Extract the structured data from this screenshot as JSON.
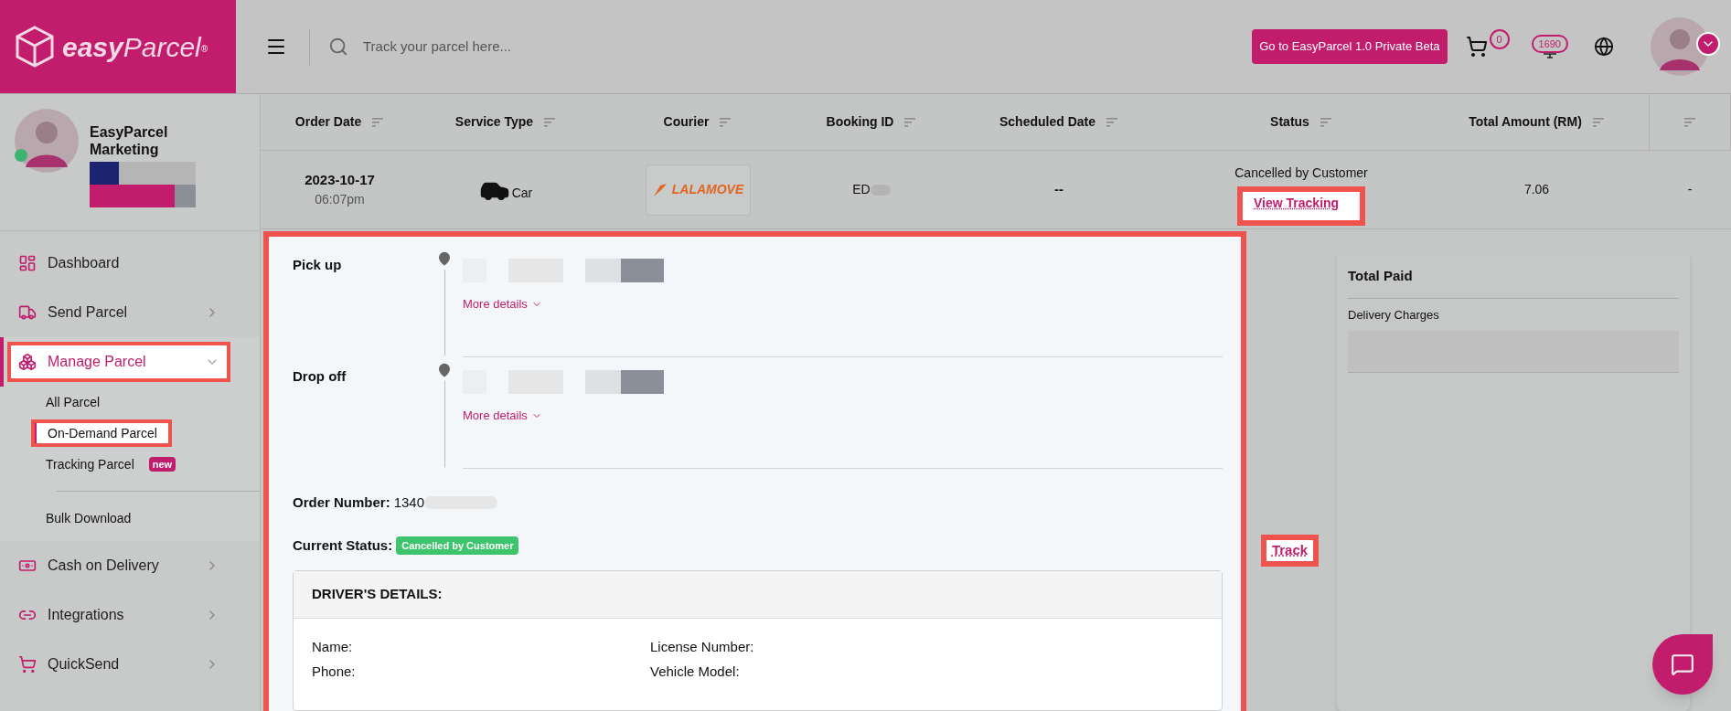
{
  "header": {
    "logo": {
      "word": "easy",
      "word2": "Parcel",
      "mark": "®"
    },
    "search": {
      "placeholder": "Track your parcel here..."
    },
    "beta_button": "Go to EasyParcel 1.0 Private Beta",
    "cart_count": "0",
    "credits": "1690"
  },
  "sidebar": {
    "profile": {
      "name": "EasyParcel Marketing",
      "online": true
    },
    "items": [
      {
        "kind": "dashboard",
        "label": "Dashboard",
        "selected": false,
        "highlighted": false,
        "expandable": false
      },
      {
        "kind": "truck",
        "label": "Send Parcel",
        "selected": false,
        "highlighted": false,
        "expandable": true,
        "expanded": false
      },
      {
        "kind": "boxes",
        "label": "Manage Parcel",
        "selected": true,
        "highlighted": true,
        "expandable": true,
        "expanded": true,
        "children": [
          {
            "label": "All Parcel",
            "selected": false,
            "highlighted": false
          },
          {
            "label": "On-Demand Parcel",
            "selected": true,
            "highlighted": true
          },
          {
            "label": "Tracking Parcel",
            "badge": "new",
            "selected": false,
            "highlighted": false
          },
          {
            "label": "Bulk Download",
            "separated": true,
            "selected": false,
            "highlighted": false
          }
        ]
      },
      {
        "kind": "cash",
        "label": "Cash on Delivery",
        "selected": false,
        "highlighted": false,
        "expandable": true,
        "expanded": false
      },
      {
        "kind": "link",
        "label": "Integrations",
        "selected": false,
        "highlighted": false,
        "expandable": true,
        "expanded": false
      },
      {
        "kind": "cart",
        "label": "QuickSend",
        "selected": false,
        "highlighted": false,
        "expandable": true,
        "expanded": false
      }
    ]
  },
  "table": {
    "columns": [
      "Order Date",
      "Service Type",
      "Courier",
      "Booking ID",
      "Scheduled Date",
      "Status",
      "Total Amount (RM)",
      ""
    ],
    "row": {
      "order_date": "2023-10-17",
      "order_time": "06:07pm",
      "service_type": "Car",
      "courier_logo": "LALAMOVE",
      "booking_id": "ED",
      "scheduled_date": "--",
      "status": "Cancelled by Customer",
      "view_tracking": {
        "label": "View Tracking",
        "highlighted": true
      },
      "total_amount": "7.06",
      "column_8": "-"
    }
  },
  "details": {
    "highlighted": true,
    "pickup": {
      "label": "Pick up",
      "more": "More details"
    },
    "dropoff": {
      "label": "Drop off",
      "more": "More details"
    },
    "order_number": {
      "label": "Order Number:",
      "value": "1340"
    },
    "current_status": {
      "label": "Current Status:",
      "badge": "Cancelled by Customer",
      "color": "#3ec46d"
    },
    "track": {
      "label": "Track",
      "highlighted": true
    },
    "driver": {
      "title": "DRIVER'S DETAILS:",
      "fields": [
        "Name:",
        "License Number:",
        "Phone:",
        "Vehicle Model:"
      ]
    }
  },
  "summary": {
    "title": "Total Paid",
    "rows": [
      "Delivery Charges"
    ]
  }
}
